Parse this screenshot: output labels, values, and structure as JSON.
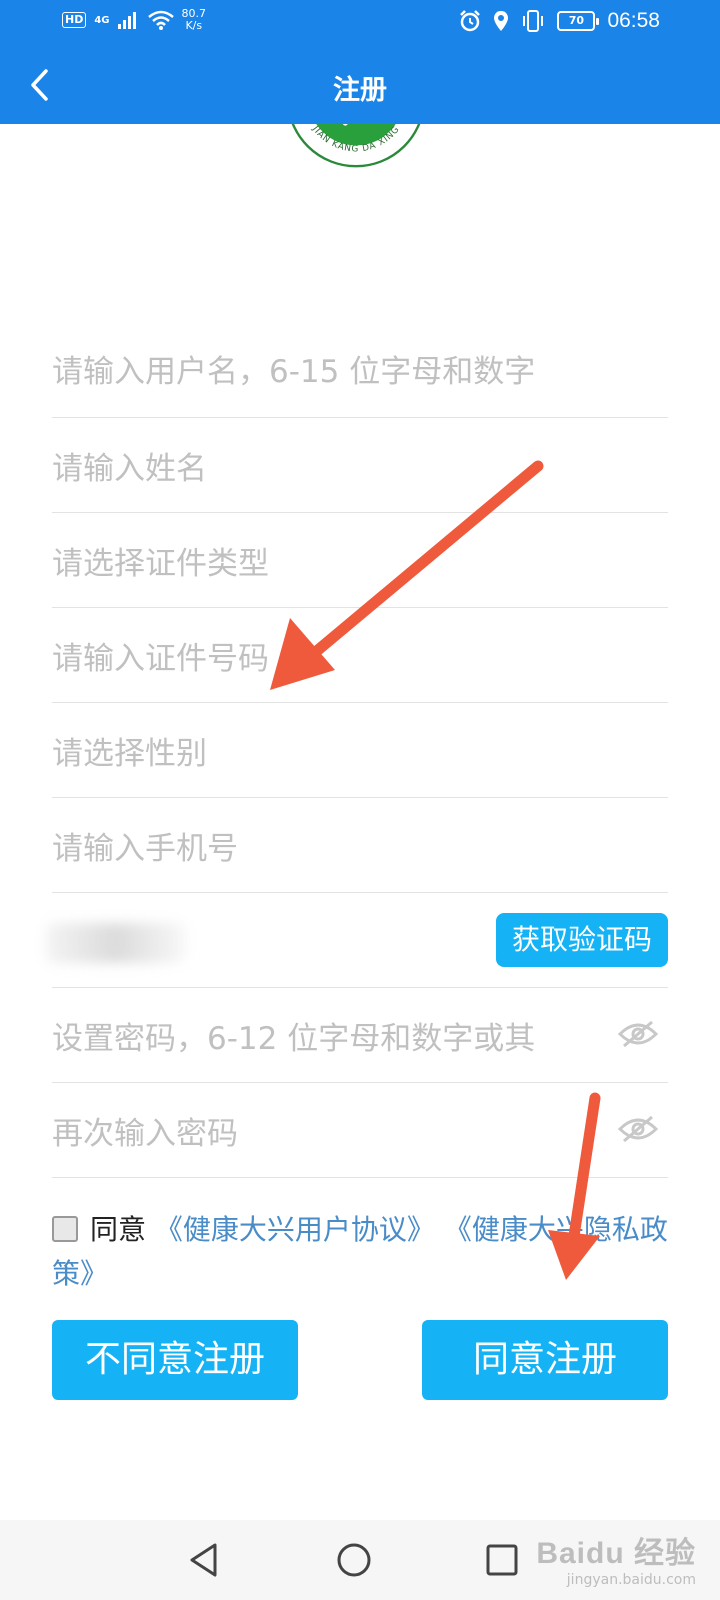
{
  "status_bar": {
    "hd": "HD",
    "network": "4G",
    "speed_value": "80.7",
    "speed_unit": "K/s",
    "battery": "70",
    "time": "06:58"
  },
  "header": {
    "title": "注册",
    "back_icon": "chevron-left-icon"
  },
  "logo": {
    "text": "JIAN KANG DA XING",
    "colors": {
      "green": "#2aa03c",
      "ring": "#2a8a3a"
    }
  },
  "form": {
    "username_placeholder": "请输入用户名，6-15 位字母和数字",
    "name_placeholder": "请输入姓名",
    "id_type_placeholder": "请选择证件类型",
    "id_number_placeholder": "请输入证件号码",
    "gender_placeholder": "请选择性别",
    "phone_placeholder": "请输入手机号",
    "get_code_label": "获取验证码",
    "password_placeholder": "设置密码，6-12 位字母和数字或其",
    "confirm_password_placeholder": "再次输入密码"
  },
  "agreement": {
    "checked": false,
    "prefix": "同意",
    "user_agreement": "《健康大兴用户协议》",
    "privacy_policy": "《健康大兴隐私政策》"
  },
  "buttons": {
    "disagree": "不同意注册",
    "agree": "同意注册"
  },
  "watermark": {
    "main": "Baidu 经验",
    "sub": "jingyan.baidu.com"
  },
  "colors": {
    "primary": "#1a84e8",
    "button": "#15b3f5",
    "link": "#4a8cc8",
    "placeholder": "#c0c0c0",
    "arrow": "#ef5a3c"
  }
}
